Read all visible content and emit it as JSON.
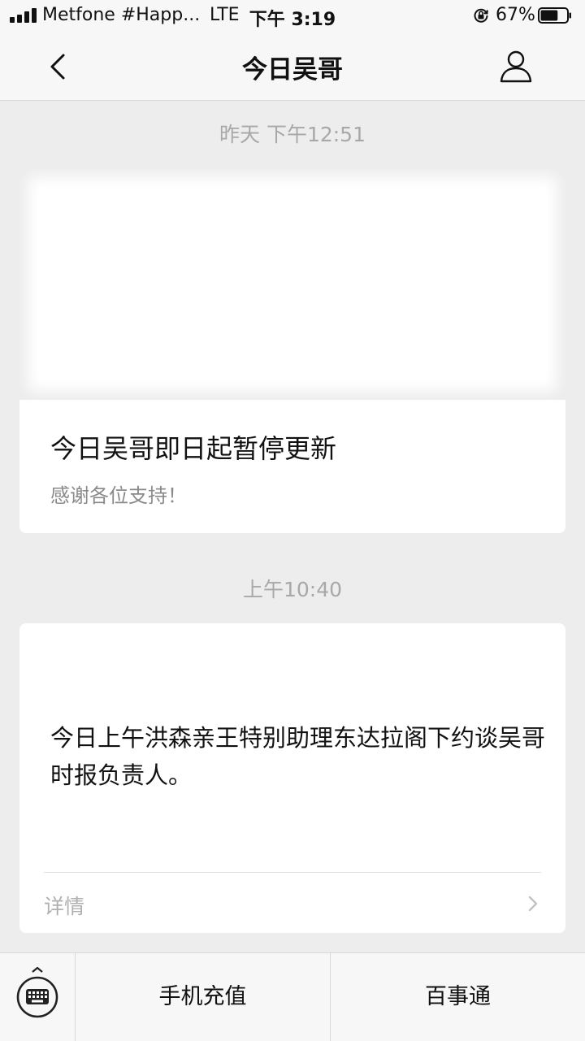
{
  "status_bar": {
    "carrier": "Metfone #Happ...",
    "network": "LTE",
    "time": "下午 3:19",
    "battery_percent": "67%",
    "battery_level": 0.67,
    "signal_bars": 4
  },
  "nav": {
    "title": "今日吴哥",
    "back_icon": "chevron-left-icon",
    "profile_icon": "person-icon"
  },
  "messages": [
    {
      "timestamp": "昨天 下午12:51",
      "title": "今日吴哥即日起暂停更新",
      "description": "感谢各位支持！"
    },
    {
      "timestamp": "上午10:40",
      "text": "今日上午洪森亲王特别助理东达拉阁下约谈吴哥时报负责人。",
      "details_label": "详情"
    }
  ],
  "bottom_menu": {
    "keyboard_icon": "keyboard-icon",
    "items": [
      "手机充值",
      "百事通"
    ]
  }
}
